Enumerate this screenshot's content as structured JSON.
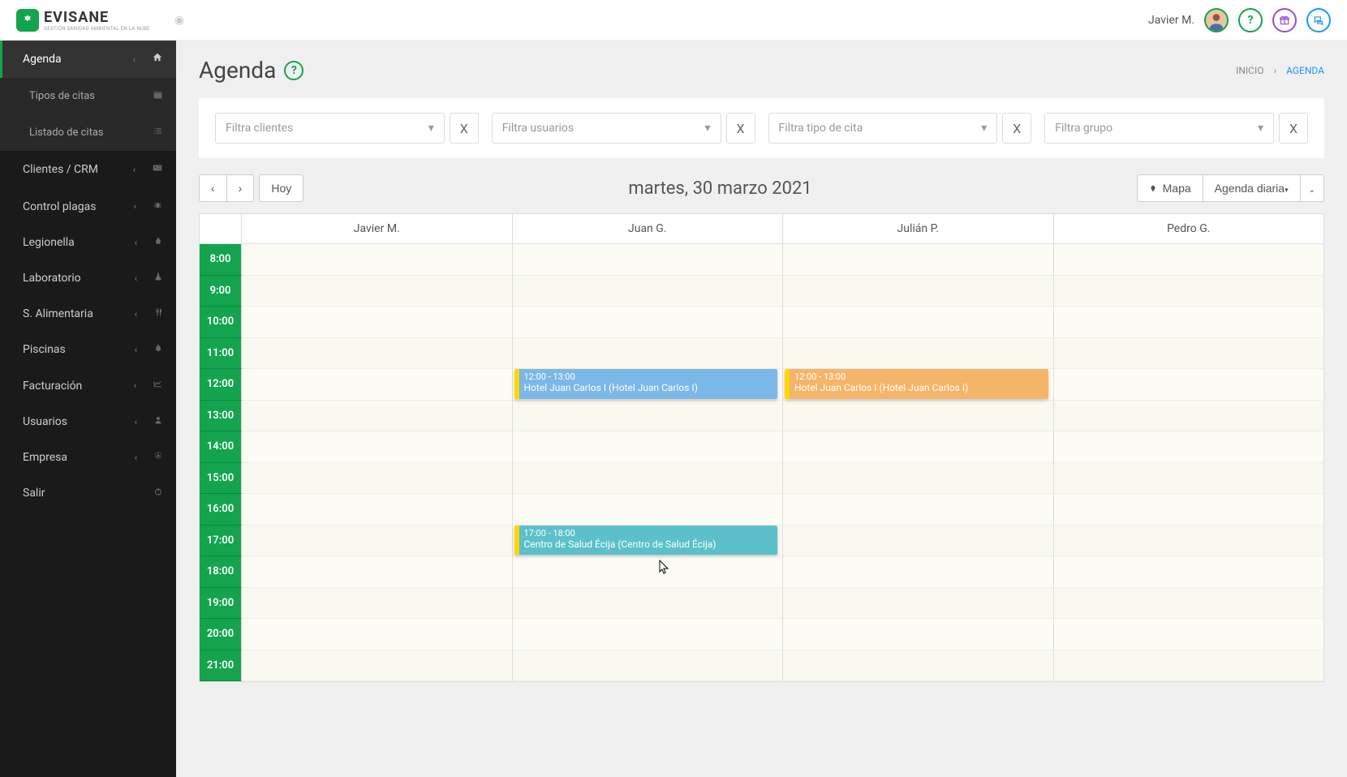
{
  "brand": {
    "name": "EVISANE",
    "tagline": "GESTIÓN SANIDAD AMBIENTAL EN LA NUBE"
  },
  "user": {
    "name": "Javier M."
  },
  "sidebar": {
    "items": [
      {
        "label": "Agenda",
        "active": true,
        "sub": [
          {
            "label": "Tipos de citas"
          },
          {
            "label": "Listado de citas"
          }
        ]
      },
      {
        "label": "Clientes / CRM"
      },
      {
        "label": "Control plagas"
      },
      {
        "label": "Legionella"
      },
      {
        "label": "Laboratorio"
      },
      {
        "label": "S. Alimentaria"
      },
      {
        "label": "Piscinas"
      },
      {
        "label": "Facturación"
      },
      {
        "label": "Usuarios"
      },
      {
        "label": "Empresa"
      },
      {
        "label": "Salir"
      }
    ]
  },
  "page": {
    "title": "Agenda"
  },
  "breadcrumb": {
    "root": "INICIO",
    "current": "AGENDA"
  },
  "filters": {
    "clientes": {
      "placeholder": "Filtra clientes"
    },
    "usuarios": {
      "placeholder": "Filtra usuarios"
    },
    "tipo": {
      "placeholder": "Filtra tipo de cita"
    },
    "grupo": {
      "placeholder": "Filtra grupo"
    }
  },
  "toolbar": {
    "hoy": "Hoy",
    "mapa": "Mapa",
    "view": "Agenda diaria"
  },
  "calendar": {
    "title": "martes, 30 marzo 2021",
    "columns": [
      "Javier M.",
      "Juan G.",
      "Julián P.",
      "Pedro G."
    ],
    "hours": [
      "8:00",
      "9:00",
      "10:00",
      "11:00",
      "12:00",
      "13:00",
      "14:00",
      "15:00",
      "16:00",
      "17:00",
      "18:00",
      "19:00",
      "20:00",
      "21:00"
    ],
    "events": [
      {
        "col": 1,
        "start": "12:00",
        "end": "13:00",
        "time": "12:00 - 13:00",
        "title": "Hotel Juan Carlos I (Hotel Juan Carlos I)",
        "color": "blue"
      },
      {
        "col": 2,
        "start": "12:00",
        "end": "13:00",
        "time": "12:00 - 13:00",
        "title": "Hotel Juan Carlos I (Hotel Juan Carlos I)",
        "color": "orange"
      },
      {
        "col": 1,
        "start": "17:00",
        "end": "18:00",
        "time": "17:00 - 18:00",
        "title": "Centro de Salud Écija (Centro de Salud Écija)",
        "color": "teal"
      }
    ]
  }
}
